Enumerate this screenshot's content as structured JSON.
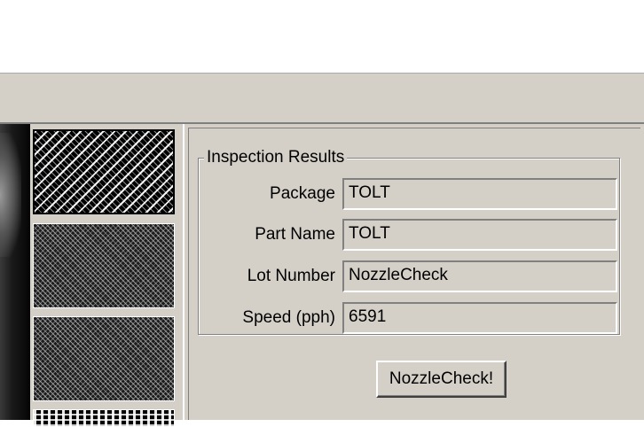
{
  "inspection_results": {
    "title": "Inspection Results",
    "fields": [
      {
        "label": "Package",
        "value": "TOLT"
      },
      {
        "label": "Part Name",
        "value": "TOLT"
      },
      {
        "label": "Lot Number",
        "value": "NozzleCheck"
      },
      {
        "label": "Speed (pph)",
        "value": "6591"
      }
    ]
  },
  "actions": {
    "nozzle_check_label": "NozzleCheck!"
  },
  "colors": {
    "window_face": "#d4d0c8",
    "shadow": "#808080",
    "highlight": "#ffffff"
  }
}
